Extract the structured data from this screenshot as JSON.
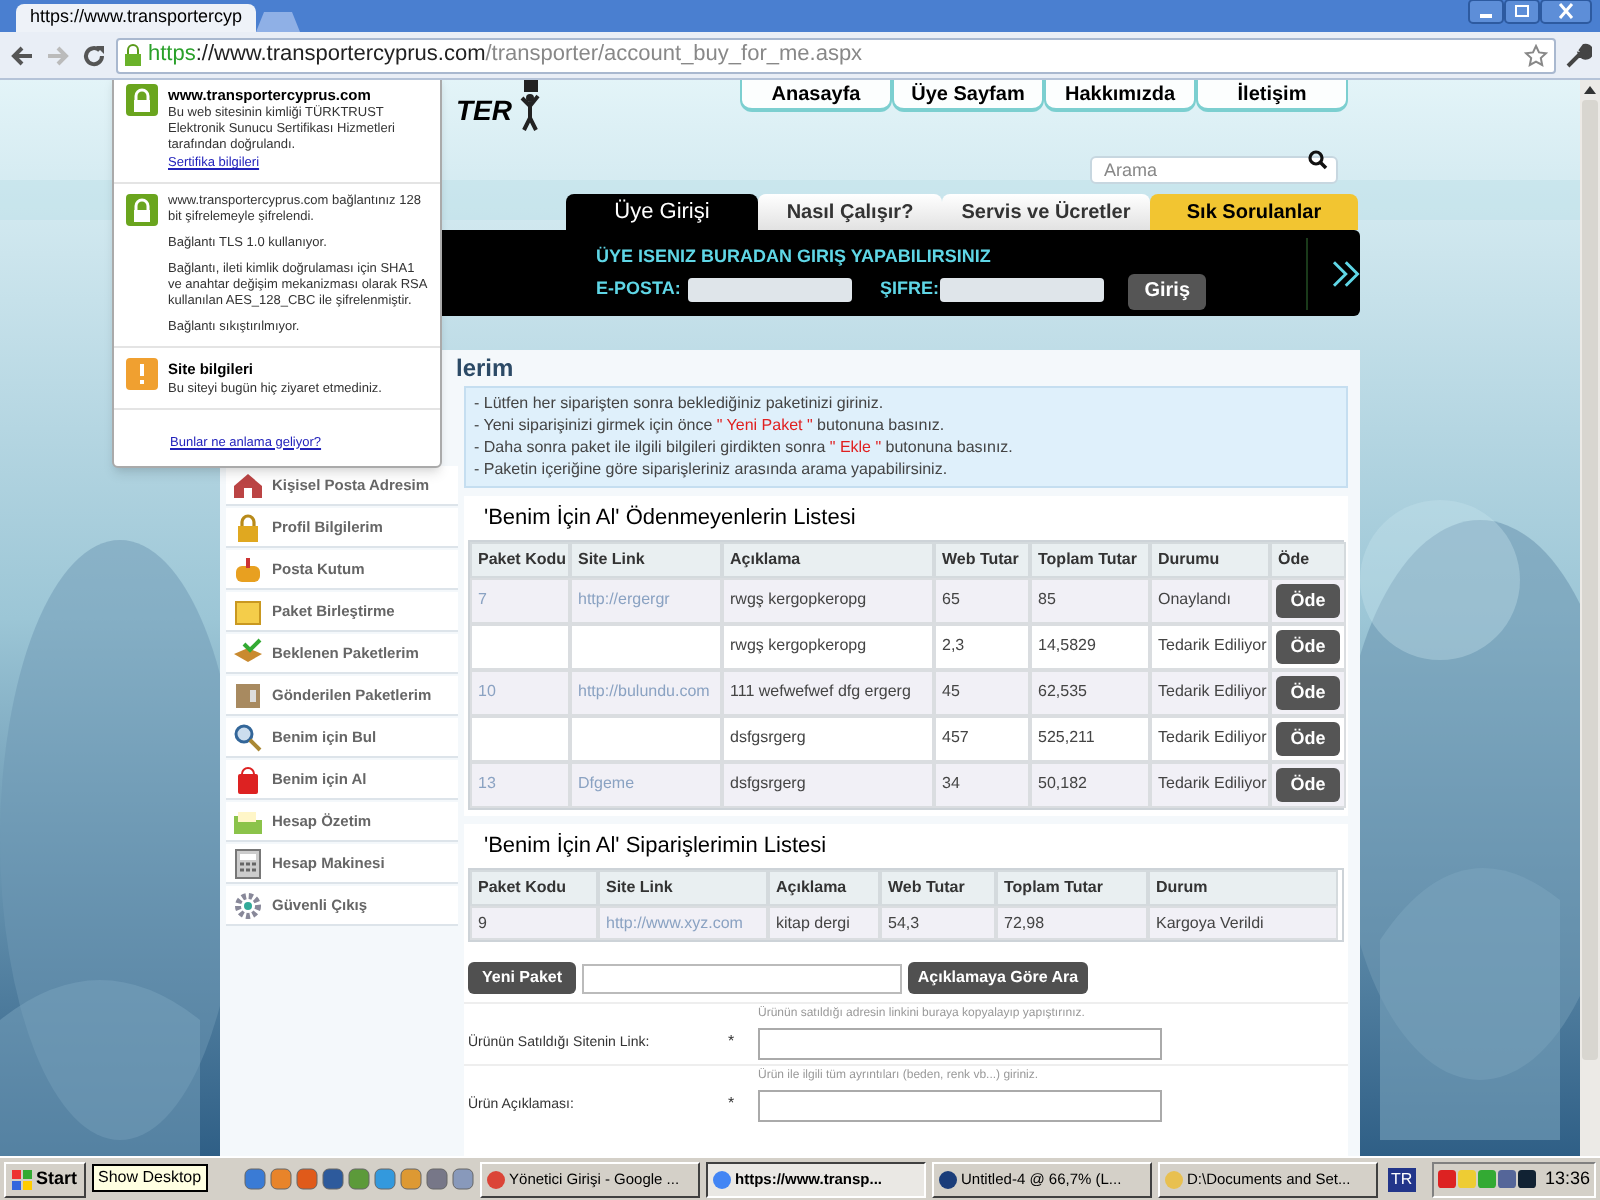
{
  "browser": {
    "tab_title": "https://www.transportercyp",
    "url_scheme": "https",
    "url_host": "://www.transportercyprus.com",
    "url_path": "/transporter/account_buy_for_me.aspx"
  },
  "security_popup": {
    "sections": [
      {
        "kind": "verified",
        "title": "www.transportercyprus.com",
        "paragraphs": [
          "Bu web sitesinin kimliği TÜRKTRUST Elektronik Sunucu Sertifikası Hizmetleri tarafından doğrulandı."
        ],
        "link": "Sertifika bilgileri"
      },
      {
        "kind": "encrypted",
        "paragraphs": [
          "www.transportercyprus.com bağlantınız 128 bit şifrelemeyle şifrelendi.",
          "Bağlantı TLS 1.0 kullanıyor.",
          "Bağlantı, ileti kimlik doğrulaması için SHA1 ve anahtar değişim mekanizması olarak RSA kullanılan AES_128_CBC ile şifrelenmiştir.",
          "Bağlantı sıkıştırılmıyor."
        ]
      },
      {
        "kind": "warning",
        "title": "Site bilgileri",
        "paragraphs": [
          "Bu siteyi bugün hiç ziyaret etmediniz."
        ]
      }
    ],
    "footer_link": "Bunlar ne anlama geliyor?"
  },
  "logo": "TER",
  "site_nav": [
    "Anasayfa",
    "Üye Sayfam",
    "Hakkımızda",
    "İletişim"
  ],
  "search": {
    "placeholder": "Arama"
  },
  "tabs": [
    {
      "label": "Üye Girişi",
      "selected": true,
      "kind": "normal"
    },
    {
      "label": "Nasıl Çalışır?",
      "selected": false,
      "kind": "normal"
    },
    {
      "label": "Servis ve Ücretler",
      "selected": false,
      "kind": "normal"
    },
    {
      "label": "Sık Sorulanlar",
      "selected": false,
      "kind": "featured"
    }
  ],
  "login": {
    "heading": "ÜYE ISENIZ BURADAN GIRIŞ YAPABILIRSINIZ",
    "email_label": "E-POSTA:",
    "password_label": "ŞIFRE:",
    "button": "Giriş"
  },
  "page_title": "lerim",
  "sidebar": [
    "Kişisel Posta Adresim",
    "Profil Bilgilerim",
    "Posta Kutum",
    "Paket Birleştirme",
    "Beklenen Paketlerim",
    "Gönderilen Paketlerim",
    "Benim için Bul",
    "Benim için Al",
    "Hesap Özetim",
    "Hesap Makinesi",
    "Güvenli Çıkış"
  ],
  "instructions": [
    "- Lütfen her siparişten sonra beklediğiniz paketinizi giriniz.",
    "- Yeni siparişinizi girmek için önce **\" Yeni Paket \"** butonuna basınız.",
    "- Daha sonra paket ile ilgili bilgileri girdikten sonra **\" Ekle \"** butonuna basınız.",
    "- Paketin içeriğine göre siparişleriniz arasında arama yapabilirsiniz."
  ],
  "unpaid_table": {
    "title": "'Benim İçin Al' Ödenmeyenlerin Listesi",
    "columns": [
      "Paket Kodu",
      "Site Link",
      "Açıklama",
      "Web Tutar",
      "Toplam Tutar",
      "Durumu",
      "Öde"
    ],
    "rows": [
      {
        "cells": [
          "7",
          "http://ergergr",
          "rwgş kergopkeropg",
          "65",
          "85",
          "Onaylandı"
        ],
        "button": "Öde"
      },
      {
        "cells": [
          "",
          "",
          "rwgş kergopkeropg",
          "2,3",
          "14,5829",
          "Tedarik Ediliyor"
        ],
        "button": "Öde"
      },
      {
        "cells": [
          "10",
          "http://bulundu.com",
          "111 wefwefwef dfg ergerg",
          "45",
          "62,535",
          "Tedarik Ediliyor"
        ],
        "button": "Öde"
      },
      {
        "cells": [
          "",
          "",
          "dsfgsrgerg",
          "457",
          "525,211",
          "Tedarik Ediliyor"
        ],
        "button": "Öde"
      },
      {
        "cells": [
          "13",
          "Dfgeme",
          "dsfgsrgerg",
          "34",
          "50,182",
          "Tedarik Ediliyor"
        ],
        "button": "Öde"
      }
    ]
  },
  "orders_table": {
    "title": "'Benim İçin Al' Siparişlerimin Listesi",
    "columns": [
      "Paket Kodu",
      "Site Link",
      "Açıklama",
      "Web Tutar",
      "Toplam Tutar",
      "Durum"
    ],
    "rows": [
      {
        "cells": [
          "9",
          "http://www.xyz.com",
          "kitap dergi",
          "54,3",
          "72,98",
          "Kargoya Verildi"
        ]
      }
    ]
  },
  "actions": {
    "new_button": "Yeni Paket",
    "search_button": "Açıklamaya Göre Ara"
  },
  "form": [
    {
      "label": "Ürünün Satıldığı Sitenin Link:",
      "required": "*",
      "hint": "Ürünün satıldığı adresin linkini buraya kopyalayıp yapıştırınız."
    },
    {
      "label": "Ürün Açıklaması:",
      "required": "*",
      "hint": "Ürün ile ilgili tüm ayrıntıları (beden, renk vb...) giriniz."
    }
  ],
  "taskbar": {
    "start": "Start",
    "tooltip": "Show Desktop",
    "tasks": [
      {
        "label": "Yönetici Girişi - Google ...",
        "selected": false
      },
      {
        "label": "https://www.transp...",
        "selected": true
      },
      {
        "label": "Untitled-4 @ 66,7% (L...",
        "selected": false
      },
      {
        "label": "D:\\Documents and Set...",
        "selected": false
      }
    ],
    "language": "TR",
    "clock": "13:36"
  }
}
